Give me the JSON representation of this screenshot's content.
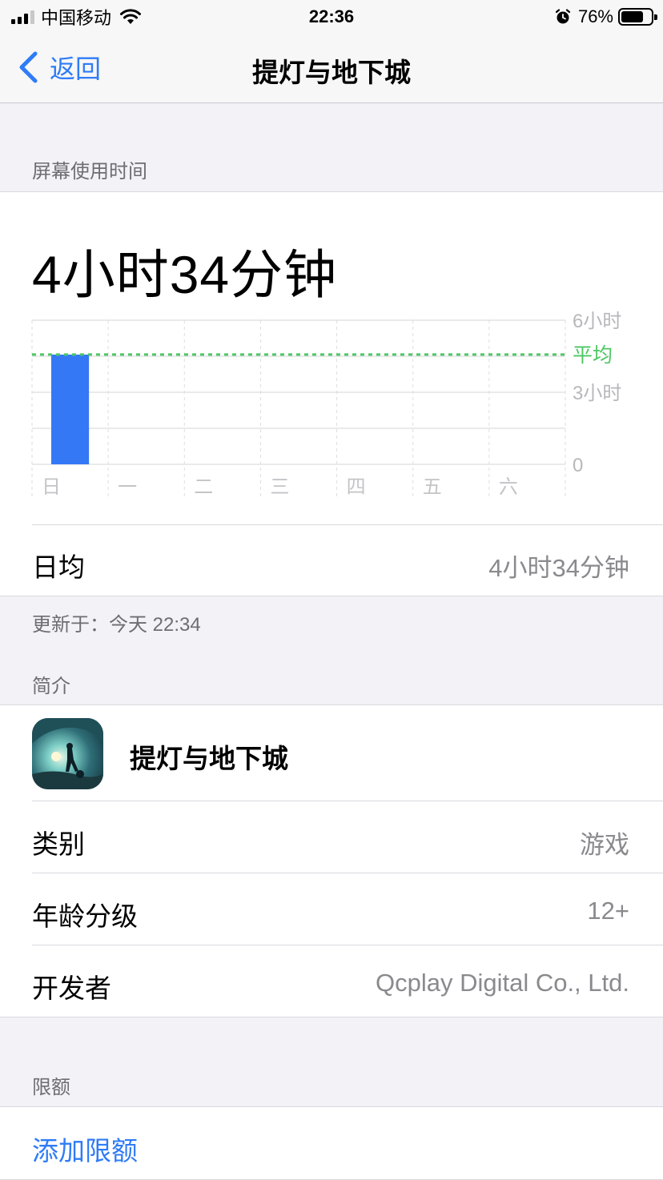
{
  "status_bar": {
    "carrier": "中国移动",
    "time": "22:36",
    "battery_percent": "76%",
    "battery_level": 0.76,
    "icons": [
      "signal-icon",
      "wifi-icon",
      "alarm-icon",
      "battery-icon"
    ]
  },
  "nav": {
    "back_label": "返回",
    "title": "提灯与地下城"
  },
  "screen_time": {
    "section_header": "屏幕使用时间",
    "total": "4小时34分钟",
    "daily_avg_label": "日均",
    "daily_avg_value": "4小时34分钟",
    "updated": "更新于：今天 22:34"
  },
  "chart_data": {
    "type": "bar",
    "categories": [
      "日",
      "一",
      "二",
      "三",
      "四",
      "五",
      "六"
    ],
    "values": [
      4.57,
      0,
      0,
      0,
      0,
      0,
      0
    ],
    "average": 4.57,
    "average_label": "平均",
    "ylim": [
      0,
      6
    ],
    "y_ticks": [
      {
        "value": 6,
        "label": "6小时"
      },
      {
        "value": 3,
        "label": "3小时"
      },
      {
        "value": 0,
        "label": "0"
      }
    ],
    "bar_color": "#3478f6",
    "average_color": "#4cc764",
    "grid": true
  },
  "info": {
    "section_header": "简介",
    "app_name": "提灯与地下城",
    "category_label": "类别",
    "category_value": "游戏",
    "age_label": "年龄分级",
    "age_value": "12+",
    "developer_label": "开发者",
    "developer_value": "Qcplay Digital Co., Ltd."
  },
  "limits": {
    "section_header": "限额",
    "add_label": "添加限额"
  },
  "colors": {
    "accent": "#2f7cf6",
    "secondary_text": "#8a8a8e",
    "background": "#f2f2f7"
  }
}
